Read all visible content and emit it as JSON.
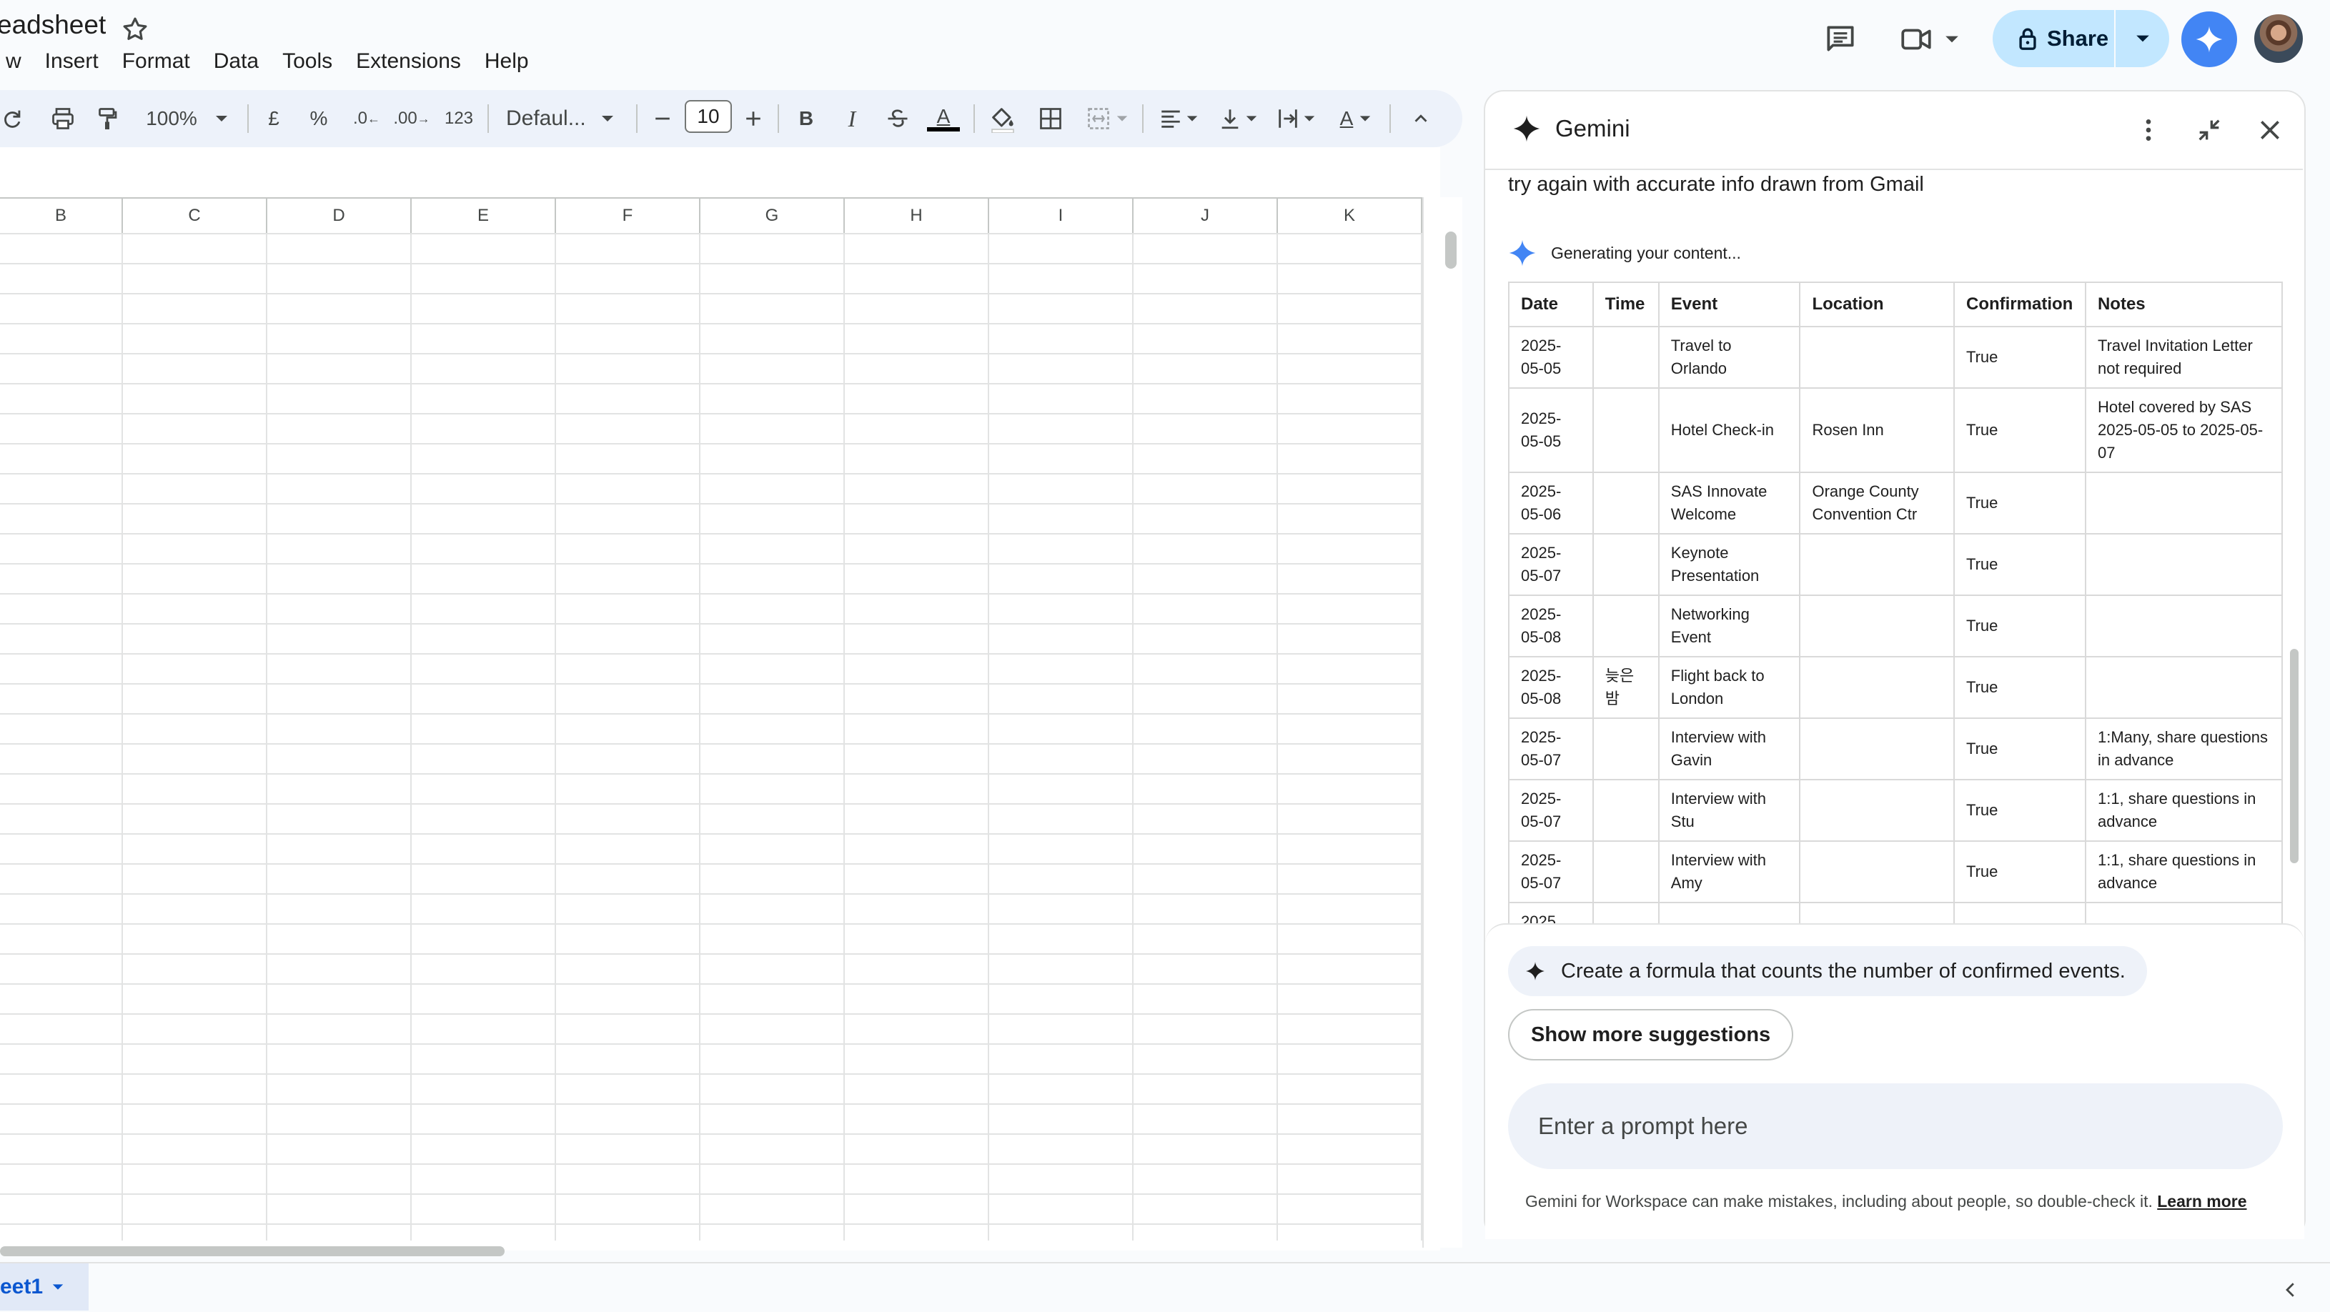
{
  "doc": {
    "title": "eadsheet"
  },
  "menu": [
    "w",
    "Insert",
    "Format",
    "Data",
    "Tools",
    "Extensions",
    "Help"
  ],
  "toolbar": {
    "zoom": "100%",
    "currency": "£",
    "percent": "%",
    "dec_less": ".0",
    "dec_more": ".00",
    "format_123": "123",
    "font": "Defaul...",
    "font_size": "10",
    "bold": "B",
    "italic": "I",
    "text_color_glyph": "A",
    "text_rotate_glyph": "A"
  },
  "header": {
    "share_label": "Share"
  },
  "sheet": {
    "columns": [
      "B",
      "C",
      "D",
      "E",
      "F",
      "G",
      "H",
      "I",
      "J",
      "K"
    ],
    "tab_label": "eet1"
  },
  "gemini": {
    "title": "Gemini",
    "query": "try again with accurate info drawn from Gmail",
    "status": "Generating your content...",
    "table": {
      "headers": [
        "Date",
        "Time",
        "Event",
        "Location",
        "Confirmation",
        "Notes"
      ],
      "rows": [
        {
          "date": "2025-05-05",
          "time": "",
          "event": "Travel to Orlando",
          "location": "",
          "confirmation": "True",
          "notes": "Travel Invitation Letter not required"
        },
        {
          "date": "2025-05-05",
          "time": "",
          "event": "Hotel Check-in",
          "location": "Rosen Inn",
          "confirmation": "True",
          "notes": "Hotel covered by SAS 2025-05-05 to 2025-05-07"
        },
        {
          "date": "2025-05-06",
          "time": "",
          "event": "SAS Innovate Welcome",
          "location": "Orange County Convention Ctr",
          "confirmation": "True",
          "notes": ""
        },
        {
          "date": "2025-05-07",
          "time": "",
          "event": "Keynote Presentation",
          "location": "",
          "confirmation": "True",
          "notes": ""
        },
        {
          "date": "2025-05-08",
          "time": "",
          "event": "Networking Event",
          "location": "",
          "confirmation": "True",
          "notes": ""
        },
        {
          "date": "2025-05-08",
          "time": "늦은 밤",
          "event": "Flight back to London",
          "location": "",
          "confirmation": "True",
          "notes": ""
        },
        {
          "date": "2025-05-07",
          "time": "",
          "event": "Interview with Gavin",
          "location": "",
          "confirmation": "True",
          "notes": "1:Many, share questions in advance"
        },
        {
          "date": "2025-05-07",
          "time": "",
          "event": "Interview with Stu",
          "location": "",
          "confirmation": "True",
          "notes": "1:1, share questions in advance"
        },
        {
          "date": "2025-05-07",
          "time": "",
          "event": "Interview with Amy",
          "location": "",
          "confirmation": "True",
          "notes": "1:1, share questions in advance"
        },
        {
          "date": "2025",
          "time": "",
          "event": "",
          "location": "",
          "confirmation": "",
          "notes": ""
        }
      ]
    },
    "suggestion": "Create a formula that counts the number of confirmed events.",
    "more_suggestions": "Show more suggestions",
    "prompt_placeholder": "Enter a prompt here",
    "disclaimer": "Gemini for Workspace can make mistakes, including about people, so double-check it.",
    "learn_more": "Learn more"
  },
  "icons": {
    "star": "star-icon",
    "comment": "comment-icon",
    "meet": "video-camera-icon",
    "lock": "lock-icon",
    "sparkle": "gemini-sparkle-icon",
    "more": "more-vert-icon",
    "minimize": "minimize-icon",
    "close": "close-icon"
  },
  "colors": {
    "share_bg": "#c2e7ff",
    "gemini_blue": "#4285f4",
    "toolbar_bg": "#edf2fa",
    "tab_active": "#0b57d0"
  }
}
